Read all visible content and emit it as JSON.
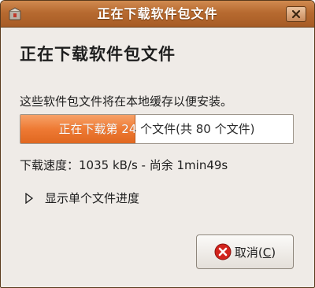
{
  "window": {
    "title": "正在下载软件包文件",
    "app_icon": "package-manager-icon",
    "close_icon": "close-icon"
  },
  "dialog": {
    "heading": "正在下载软件包文件",
    "description": "这些软件包文件将在本地缓存以便安装。",
    "progress": {
      "text": "正在下载第 24 个文件(共 80 个文件)",
      "fraction": 0.42
    },
    "speed_text": "下载速度：1035 kB/s - 尚余 1min49s",
    "expander": {
      "label": "显示单个文件进度",
      "icon": "triangle-right-icon"
    },
    "cancel": {
      "label_prefix": "取消(",
      "mnemonic": "C",
      "label_suffix": ")",
      "icon": "cancel-icon"
    }
  },
  "colors": {
    "titlebar": "#b76a30",
    "progress_fill": "#ee7a34",
    "background": "#efebe7"
  }
}
